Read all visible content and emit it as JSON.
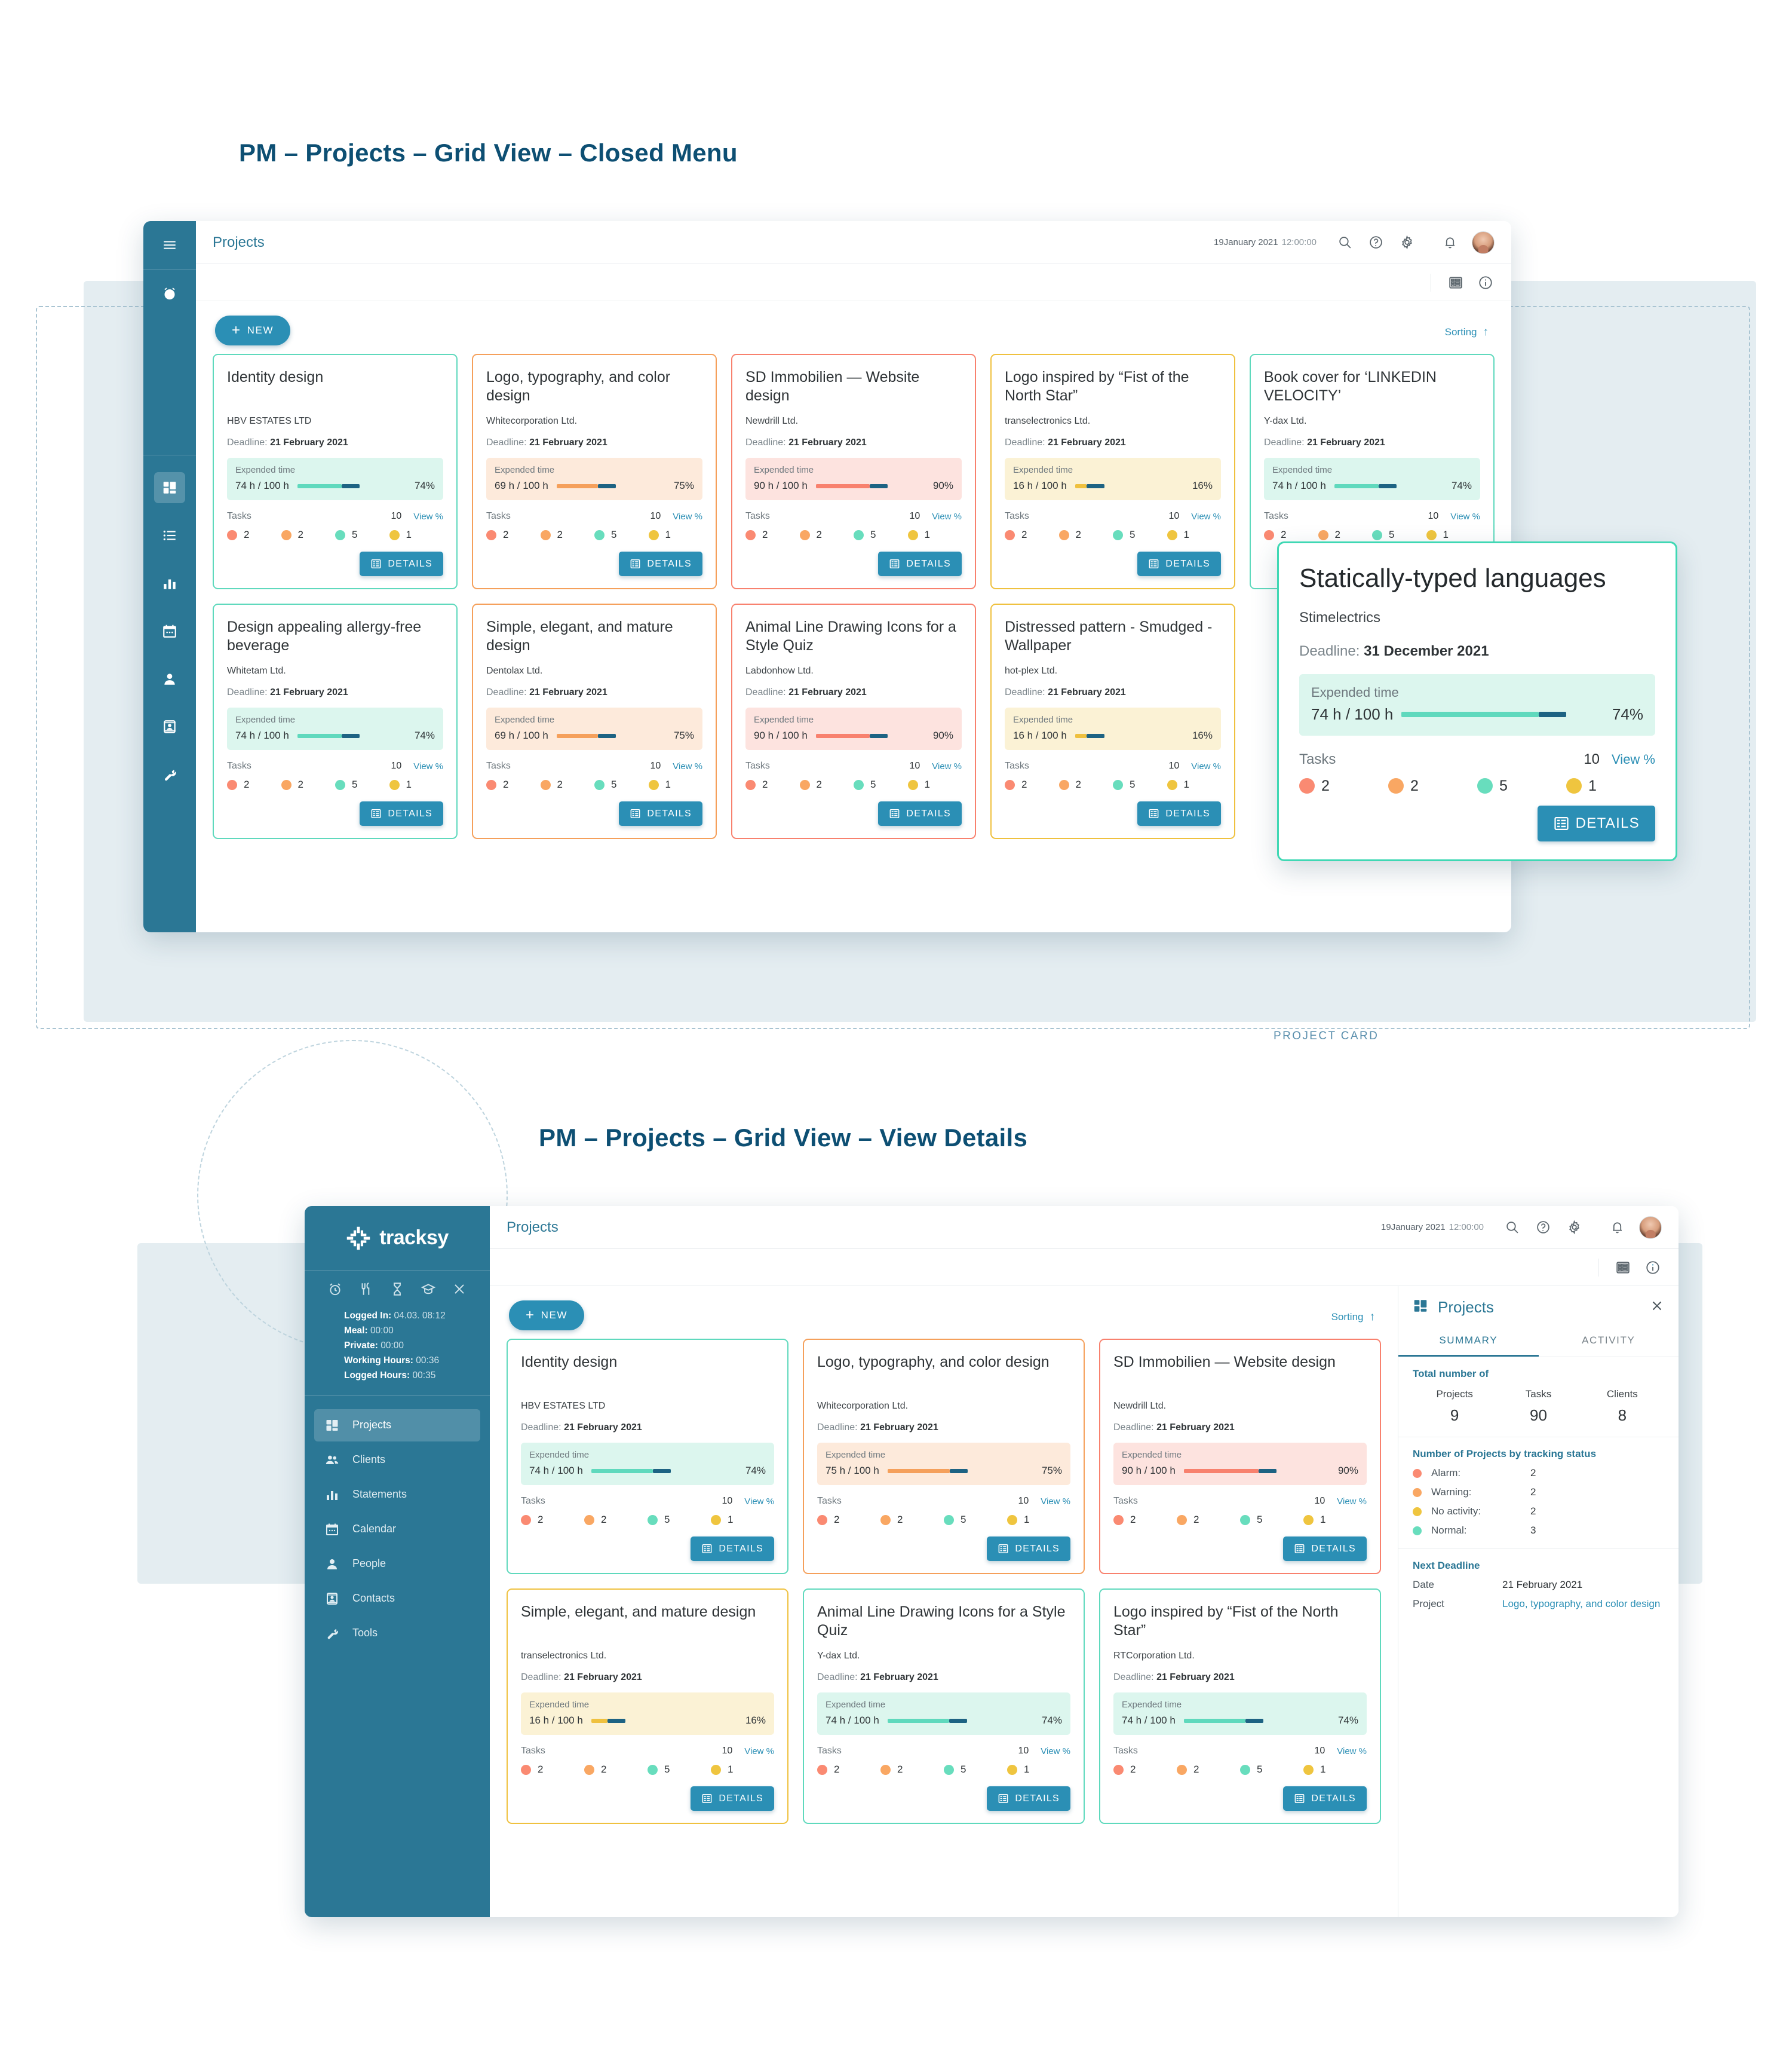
{
  "headings": {
    "section1": "PM – Projects – Grid View – Closed Menu",
    "section2": "PM – Projects – Grid View – View Details",
    "project_card_caption": "PROJECT CARD"
  },
  "colors": {
    "brand": "#2b7795",
    "accent": "#2b8fb5",
    "green": "#5fd9bd",
    "orange": "#f5a05b",
    "red": "#f8816e",
    "yellow": "#efc13f",
    "marker": "#1d6383"
  },
  "app": {
    "title": "Projects",
    "date": "19January 2021",
    "time": "12:00:00",
    "new_button": "NEW",
    "sorting_label": "Sorting",
    "details_label": "DETAILS",
    "expended_time_label": "Expended time",
    "tasks_label": "Tasks",
    "view_pct_label": "View %",
    "deadline_label": "Deadline:"
  },
  "sidebar_mini": {
    "icons": [
      "menu-icon",
      "alarm-clock-icon",
      "projects-grid-icon",
      "list-icon",
      "statements-bar-icon",
      "calendar-icon",
      "people-icon",
      "contacts-icon",
      "tools-wrench-icon"
    ]
  },
  "sidebar_full": {
    "logo_text": "tracksy",
    "quick_icons": [
      "alarm-clock-icon",
      "meal-fork-knife-icon",
      "hourglass-icon",
      "graduation-cap-icon",
      "close-icon"
    ],
    "stats": [
      {
        "label": "Logged In:",
        "value": "04.03. 08:12"
      },
      {
        "label": "Meal:",
        "value": "00:00"
      },
      {
        "label": "Private:",
        "value": "00:00"
      },
      {
        "label": "Working Hours:",
        "value": "00:36"
      },
      {
        "label": "Logged Hours:",
        "value": "00:35"
      }
    ],
    "nav": [
      {
        "label": "Projects",
        "icon": "projects-grid-icon",
        "active": true
      },
      {
        "label": "Clients",
        "icon": "clients-people-icon",
        "active": false
      },
      {
        "label": "Statements",
        "icon": "statements-bar-icon",
        "active": false
      },
      {
        "label": "Calendar",
        "icon": "calendar-icon",
        "active": false
      },
      {
        "label": "People",
        "icon": "person-icon",
        "active": false
      },
      {
        "label": "Contacts",
        "icon": "contacts-card-icon",
        "active": false
      },
      {
        "label": "Tools",
        "icon": "tools-wrench-icon",
        "active": false
      }
    ]
  },
  "summary_panel": {
    "title": "Projects",
    "tabs": [
      {
        "label": "SUMMARY",
        "active": true
      },
      {
        "label": "ACTIVITY",
        "active": false
      }
    ],
    "totals_heading": "Total number of",
    "totals": [
      {
        "key": "Projects",
        "value": "9"
      },
      {
        "key": "Tasks",
        "value": "90"
      },
      {
        "key": "Clients",
        "value": "8"
      }
    ],
    "status_heading": "Number of Projects by tracking status",
    "statuses": [
      {
        "name": "Alarm:",
        "value": "2",
        "color": "c-alarm"
      },
      {
        "name": "Warning:",
        "value": "2",
        "color": "c-warn"
      },
      {
        "name": "No activity:",
        "value": "2",
        "color": "c-none"
      },
      {
        "name": "Normal:",
        "value": "3",
        "color": "c-normal"
      }
    ],
    "deadline_heading": "Next Deadline",
    "deadline_date_key": "Date",
    "deadline_date_value": "21 February 2021",
    "deadline_project_key": "Project",
    "deadline_project_value": "Logo, typography, and color design"
  },
  "dashboard1_cards": [
    {
      "title": "Identity design",
      "client": "HBV ESTATES LTD",
      "deadline": "21 February 2021",
      "hours": "74 h / 100 h",
      "pct": "74%",
      "pct_num": 74,
      "theme": "green",
      "tasks_total": "10",
      "dots": [
        {
          "c": "c-alarm",
          "v": "2"
        },
        {
          "c": "c-warn",
          "v": "2"
        },
        {
          "c": "c-normal",
          "v": "5"
        },
        {
          "c": "c-none",
          "v": "1"
        }
      ]
    },
    {
      "title": "Logo, typography, and color design",
      "client": "Whitecorporation Ltd.",
      "deadline": "21 February 2021",
      "hours": "69 h / 100 h",
      "pct": "75%",
      "pct_num": 69,
      "theme": "orange",
      "tasks_total": "10",
      "dots": [
        {
          "c": "c-alarm",
          "v": "2"
        },
        {
          "c": "c-warn",
          "v": "2"
        },
        {
          "c": "c-normal",
          "v": "5"
        },
        {
          "c": "c-none",
          "v": "1"
        }
      ]
    },
    {
      "title": "SD Immobilien — Website design",
      "client": "Newdrill Ltd.",
      "deadline": "21 February 2021",
      "hours": "90 h / 100 h",
      "pct": "90%",
      "pct_num": 90,
      "theme": "red",
      "tasks_total": "10",
      "dots": [
        {
          "c": "c-alarm",
          "v": "2"
        },
        {
          "c": "c-warn",
          "v": "2"
        },
        {
          "c": "c-normal",
          "v": "5"
        },
        {
          "c": "c-none",
          "v": "1"
        }
      ]
    },
    {
      "title": "Logo inspired by “Fist of the North Star”",
      "client": "transelectronics Ltd.",
      "deadline": "21 February 2021",
      "hours": "16 h / 100 h",
      "pct": "16%",
      "pct_num": 16,
      "theme": "yellow",
      "tasks_total": "10",
      "dots": [
        {
          "c": "c-alarm",
          "v": "2"
        },
        {
          "c": "c-warn",
          "v": "2"
        },
        {
          "c": "c-normal",
          "v": "5"
        },
        {
          "c": "c-none",
          "v": "1"
        }
      ]
    },
    {
      "title": "Book cover for ‘LINKEDIN VELOCITY’",
      "client": "Y-dax Ltd.",
      "deadline": "21 February 2021",
      "hours": "74 h / 100 h",
      "pct": "74%",
      "pct_num": 74,
      "theme": "green",
      "tasks_total": "10",
      "dots": [
        {
          "c": "c-alarm",
          "v": "2"
        },
        {
          "c": "c-warn",
          "v": "2"
        },
        {
          "c": "c-normal",
          "v": "5"
        },
        {
          "c": "c-none",
          "v": "1"
        }
      ]
    },
    {
      "title": "Design appealing allergy-free beverage",
      "client": "Whitetam Ltd.",
      "deadline": "21 February 2021",
      "hours": "74 h / 100 h",
      "pct": "74%",
      "pct_num": 74,
      "theme": "green",
      "tasks_total": "10",
      "dots": [
        {
          "c": "c-alarm",
          "v": "2"
        },
        {
          "c": "c-warn",
          "v": "2"
        },
        {
          "c": "c-normal",
          "v": "5"
        },
        {
          "c": "c-none",
          "v": "1"
        }
      ]
    },
    {
      "title": "Simple, elegant, and mature design",
      "client": "Dentolax Ltd.",
      "deadline": "21 February 2021",
      "hours": "69 h / 100 h",
      "pct": "75%",
      "pct_num": 69,
      "theme": "orange",
      "tasks_total": "10",
      "dots": [
        {
          "c": "c-alarm",
          "v": "2"
        },
        {
          "c": "c-warn",
          "v": "2"
        },
        {
          "c": "c-normal",
          "v": "5"
        },
        {
          "c": "c-none",
          "v": "1"
        }
      ]
    },
    {
      "title": "Animal Line Drawing Icons for a Style Quiz",
      "client": "Labdonhow  Ltd.",
      "deadline": "21 February 2021",
      "hours": "90 h / 100 h",
      "pct": "90%",
      "pct_num": 90,
      "theme": "red",
      "tasks_total": "10",
      "dots": [
        {
          "c": "c-alarm",
          "v": "2"
        },
        {
          "c": "c-warn",
          "v": "2"
        },
        {
          "c": "c-normal",
          "v": "5"
        },
        {
          "c": "c-none",
          "v": "1"
        }
      ]
    },
    {
      "title": "Distressed pattern - Smudged - Wallpaper",
      "client": "hot-plex Ltd.",
      "deadline": "21 February 2021",
      "hours": "16 h / 100 h",
      "pct": "16%",
      "pct_num": 16,
      "theme": "yellow",
      "tasks_total": "10",
      "dots": [
        {
          "c": "c-alarm",
          "v": "2"
        },
        {
          "c": "c-warn",
          "v": "2"
        },
        {
          "c": "c-normal",
          "v": "5"
        },
        {
          "c": "c-none",
          "v": "1"
        }
      ]
    }
  ],
  "float_card": {
    "title": "Statically-typed languages",
    "client": "Stimelectrics",
    "deadline": "31 December 2021",
    "hours": "74 h / 100 h",
    "pct": "74%",
    "pct_num": 74,
    "theme": "green",
    "tasks_total": "10",
    "dots": [
      {
        "c": "c-alarm",
        "v": "2"
      },
      {
        "c": "c-warn",
        "v": "2"
      },
      {
        "c": "c-normal",
        "v": "5"
      },
      {
        "c": "c-none",
        "v": "1"
      }
    ]
  },
  "dashboard2_cards": [
    {
      "title": "Identity design",
      "client": "HBV ESTATES LTD",
      "deadline": "21 February 2021",
      "hours": "74 h / 100 h",
      "pct": "74%",
      "pct_num": 74,
      "theme": "green",
      "tasks_total": "10",
      "dots": [
        {
          "c": "c-alarm",
          "v": "2"
        },
        {
          "c": "c-warn",
          "v": "2"
        },
        {
          "c": "c-normal",
          "v": "5"
        },
        {
          "c": "c-none",
          "v": "1"
        }
      ]
    },
    {
      "title": "Logo, typography, and color design",
      "client": "Whitecorporation Ltd.",
      "deadline": "21 February 2021",
      "hours": "75 h / 100 h",
      "pct": "75%",
      "pct_num": 75,
      "theme": "orange",
      "tasks_total": "10",
      "dots": [
        {
          "c": "c-alarm",
          "v": "2"
        },
        {
          "c": "c-warn",
          "v": "2"
        },
        {
          "c": "c-normal",
          "v": "5"
        },
        {
          "c": "c-none",
          "v": "1"
        }
      ]
    },
    {
      "title": "SD Immobilien — Website design",
      "client": "Newdrill Ltd.",
      "deadline": "21 February 2021",
      "hours": "90 h / 100 h",
      "pct": "90%",
      "pct_num": 90,
      "theme": "red",
      "tasks_total": "10",
      "dots": [
        {
          "c": "c-alarm",
          "v": "2"
        },
        {
          "c": "c-warn",
          "v": "2"
        },
        {
          "c": "c-normal",
          "v": "5"
        },
        {
          "c": "c-none",
          "v": "1"
        }
      ]
    },
    {
      "title": "Simple, elegant, and mature design",
      "client": "transelectronics Ltd.",
      "deadline": "21 February 2021",
      "hours": "16 h / 100 h",
      "pct": "16%",
      "pct_num": 16,
      "theme": "yellow",
      "tasks_total": "10",
      "dots": [
        {
          "c": "c-alarm",
          "v": "2"
        },
        {
          "c": "c-warn",
          "v": "2"
        },
        {
          "c": "c-normal",
          "v": "5"
        },
        {
          "c": "c-none",
          "v": "1"
        }
      ]
    },
    {
      "title": "Animal Line Drawing Icons for a Style Quiz",
      "client": "Y-dax Ltd.",
      "deadline": "21 February 2021",
      "hours": "74 h / 100 h",
      "pct": "74%",
      "pct_num": 74,
      "theme": "green",
      "tasks_total": "10",
      "dots": [
        {
          "c": "c-alarm",
          "v": "2"
        },
        {
          "c": "c-warn",
          "v": "2"
        },
        {
          "c": "c-normal",
          "v": "5"
        },
        {
          "c": "c-none",
          "v": "1"
        }
      ]
    },
    {
      "title": "Logo inspired by “Fist of the North Star”",
      "client": "RTCorporation Ltd.",
      "deadline": "21 February 2021",
      "hours": "74 h / 100 h",
      "pct": "74%",
      "pct_num": 74,
      "theme": "green",
      "tasks_total": "10",
      "dots": [
        {
          "c": "c-alarm",
          "v": "2"
        },
        {
          "c": "c-warn",
          "v": "2"
        },
        {
          "c": "c-normal",
          "v": "5"
        },
        {
          "c": "c-none",
          "v": "1"
        }
      ]
    }
  ]
}
